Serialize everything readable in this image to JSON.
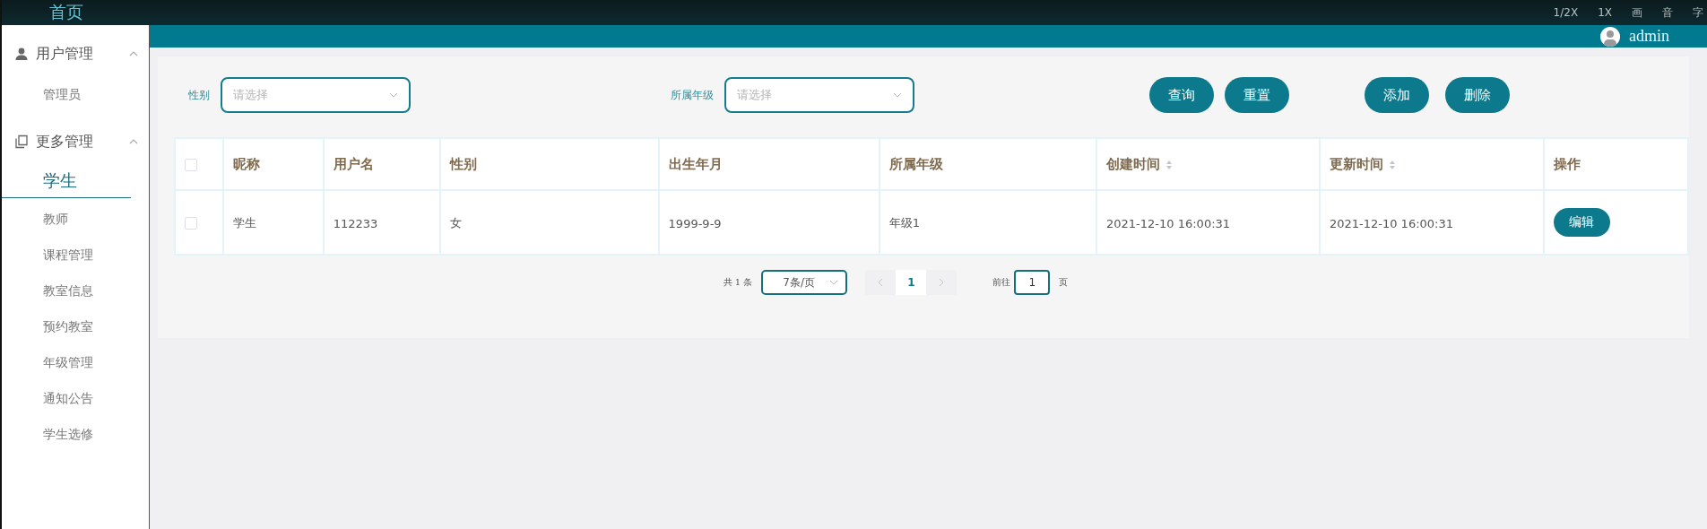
{
  "player_controls": [
    "1/2X",
    "1X",
    "画",
    "音",
    "字"
  ],
  "header": {
    "user": "admin"
  },
  "sidebar": {
    "home": "首页",
    "groups": [
      {
        "label": "用户管理",
        "kind": "user",
        "expanded": true,
        "items": [
          {
            "label": "管理员",
            "selected": false
          }
        ]
      },
      {
        "label": "更多管理",
        "kind": "copy",
        "expanded": true,
        "items": [
          {
            "label": "学生",
            "selected": true
          },
          {
            "label": "教师",
            "selected": false
          },
          {
            "label": "课程管理",
            "selected": false
          },
          {
            "label": "教室信息",
            "selected": false
          },
          {
            "label": "预约教室",
            "selected": false
          },
          {
            "label": "年级管理",
            "selected": false
          },
          {
            "label": "通知公告",
            "selected": false
          },
          {
            "label": "学生选修",
            "selected": false
          }
        ]
      }
    ]
  },
  "filters": [
    {
      "label": "性别",
      "placeholder": "请选择"
    },
    {
      "label": "所属年级",
      "placeholder": "请选择"
    }
  ],
  "search_buttons": [
    "查询",
    "重置"
  ],
  "action_buttons": [
    "添加",
    "删除"
  ],
  "table": {
    "header_checked": false,
    "columns": [
      {
        "label": "昵称",
        "sortable": false
      },
      {
        "label": "用户名",
        "sortable": false
      },
      {
        "label": "性别",
        "sortable": false
      },
      {
        "label": "出生年月",
        "sortable": false
      },
      {
        "label": "所属年级",
        "sortable": false
      },
      {
        "label": "创建时间",
        "sortable": true
      },
      {
        "label": "更新时间",
        "sortable": true
      },
      {
        "label": "操作",
        "sortable": false
      }
    ],
    "rows": [
      {
        "checked": false,
        "cells": [
          "学生",
          "112233",
          "女",
          "1999-9-9",
          "年级1",
          "2021-12-10 16:00:31",
          "2021-12-10 16:00:31"
        ],
        "action": "编辑"
      }
    ]
  },
  "pagination": {
    "total": "共 1 条",
    "page_size": "7条/页",
    "pages": [
      {
        "label": "1",
        "selected": true
      }
    ],
    "goto_label": "前往",
    "goto_value": "1",
    "goto_suffix": "页"
  }
}
